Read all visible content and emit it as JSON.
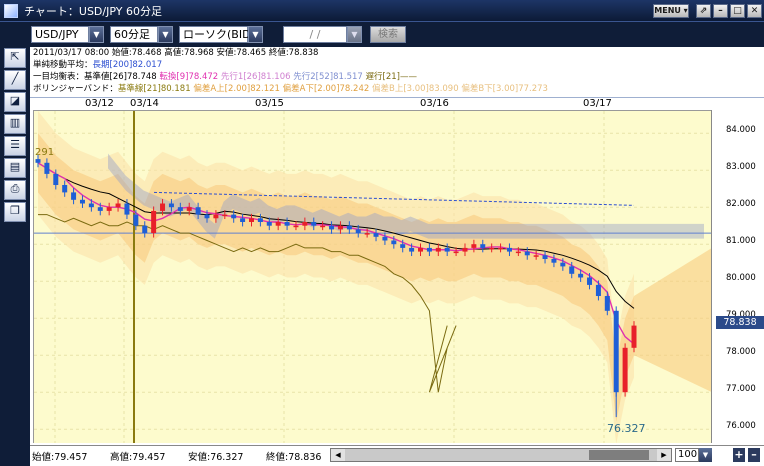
{
  "window": {
    "title": "チャート：USD/JPY 60分足",
    "menu_label": "MENU ▾",
    "btn_pin": "⇗",
    "btn_min": "–",
    "btn_max": "□",
    "btn_close": "✕"
  },
  "toolbar": {
    "pair": "USD/JPY",
    "interval": "60分足",
    "chart_type": "ローソク(BID)",
    "date_value": " /  / ",
    "search_label": "検索"
  },
  "info": {
    "line1": "2011/03/17 08:00  始値:78.468  高値:78.968  安値:78.465  終値:78.838",
    "line2_label": "単純移動平均：",
    "line2_value": "長期[200]82.017",
    "line3_label": "一目均衡表：基準値[26]78.748",
    "line3_tenkan": "転換[9]78.472",
    "line3_senko1": "先行1[26]81.106",
    "line3_senko2": "先行2[52]81.517",
    "line3_chikou": "遅行[21]——",
    "line4_label": "ボリンジャーバンド：",
    "line4_base": "基準線[21]80.181",
    "line4_up2": "偏差A上[2.00]82.121",
    "line4_dn2": "偏差A下[2.00]78.242",
    "line4_up3": "偏差B上[3.00]83.090",
    "line4_dn3": "偏差B下[3.00]77.273"
  },
  "colors": {
    "up": "#e8202a",
    "down": "#1f5fd6",
    "tenkan": "#e030b0",
    "kijun": "#000000",
    "chikou": "#7a6a10",
    "sma": "#2d4fd0",
    "cloud": "#9aa2c8",
    "band2": "#f7c97a",
    "band3": "#fbe0a8"
  },
  "xaxis": {
    "labels": [
      "03/12",
      "03/14",
      "03/15",
      "03/16",
      "03/17"
    ]
  },
  "yaxis": {
    "labels": [
      "84.000",
      "83.000",
      "82.000",
      "81.000",
      "80.000",
      "79.000",
      "78.000",
      "77.000",
      "76.000"
    ],
    "last_price": "78.838"
  },
  "annotations": {
    "top_left": "291",
    "low_label": "76.327"
  },
  "footer": {
    "open": "始値:79.457",
    "high": "高値:79.457",
    "low": "安値:76.327",
    "close": "終値:78.836",
    "zoom": "100"
  },
  "chart_data": {
    "type": "candlestick",
    "title": "USD/JPY 60分足",
    "ylim": [
      75.6,
      84.6
    ],
    "grid": true,
    "candles_close": [
      83.2,
      82.9,
      82.6,
      82.4,
      82.2,
      82.1,
      82.0,
      81.9,
      82.0,
      82.1,
      81.8,
      81.5,
      81.3,
      81.9,
      82.1,
      82.0,
      81.9,
      82.0,
      81.8,
      81.7,
      81.8,
      81.8,
      81.7,
      81.6,
      81.7,
      81.6,
      81.5,
      81.6,
      81.5,
      81.5,
      81.6,
      81.5,
      81.5,
      81.4,
      81.5,
      81.4,
      81.3,
      81.3,
      81.2,
      81.1,
      81.0,
      80.9,
      80.8,
      80.9,
      80.8,
      80.9,
      80.8,
      80.8,
      80.9,
      81.0,
      80.9,
      80.9,
      80.9,
      80.8,
      80.8,
      80.7,
      80.7,
      80.6,
      80.5,
      80.4,
      80.2,
      80.1,
      79.9,
      79.6,
      79.2,
      77.0,
      78.2,
      78.8
    ]
  }
}
